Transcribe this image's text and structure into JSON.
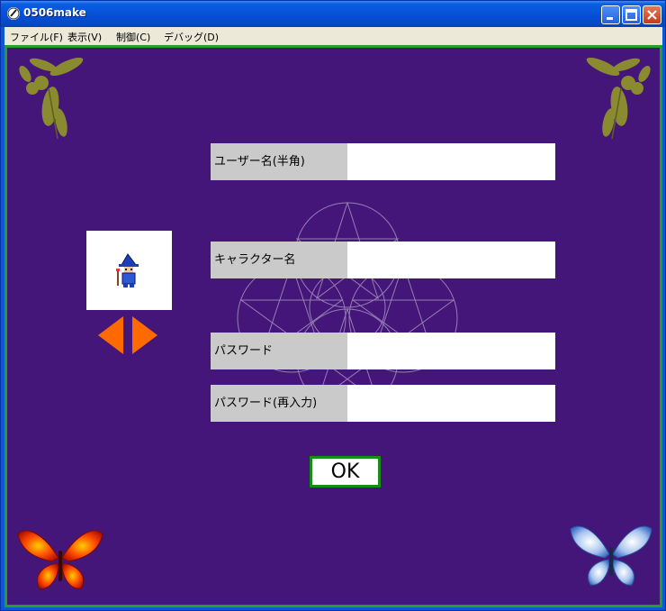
{
  "window": {
    "title": "0506make"
  },
  "menu": [
    {
      "label": "ファイル(F)"
    },
    {
      "label": "表示(V)"
    },
    {
      "label": "制御(C)"
    },
    {
      "label": "デバッグ(D)"
    }
  ],
  "form": {
    "username_label": "ユーザー名(半角)",
    "username_value": "",
    "character_label": "キャラクター名",
    "character_value": "",
    "password_label": "パスワード",
    "password_value": "",
    "password_confirm_label": "パスワード(再入力)",
    "password_confirm_value": "",
    "ok_label": "OK"
  },
  "colors": {
    "background": "#451679",
    "arrow": "#ff6a00",
    "ok_border": "#1a8a1a",
    "leaf": "#8a8a30"
  },
  "icons": {
    "left_arrow": "left-arrow-icon",
    "right_arrow": "right-arrow-icon",
    "character": "wizard-sprite"
  }
}
